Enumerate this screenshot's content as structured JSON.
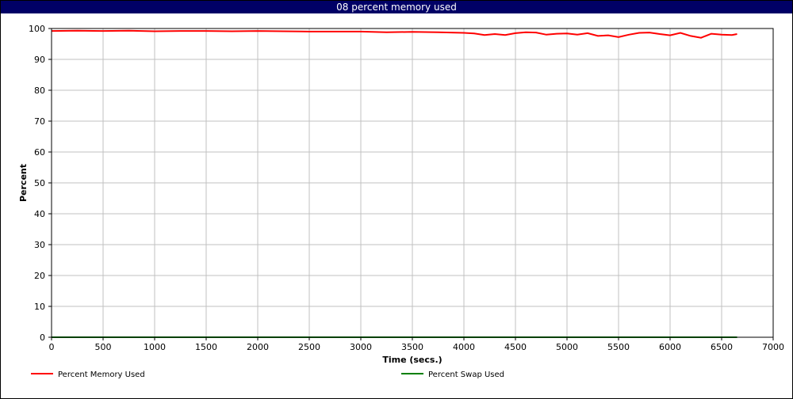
{
  "chart_data": {
    "type": "line",
    "title": "08 percent memory used",
    "xlabel": "Time (secs.)",
    "ylabel": "Percent",
    "xlim": [
      0,
      7000
    ],
    "ylim": [
      0,
      100
    ],
    "x_ticks": [
      0,
      500,
      1000,
      1500,
      2000,
      2500,
      3000,
      3500,
      4000,
      4500,
      5000,
      5500,
      6000,
      6500,
      7000
    ],
    "y_ticks": [
      0,
      10,
      20,
      30,
      40,
      50,
      60,
      70,
      80,
      90,
      100
    ],
    "grid": true,
    "legend_position": "bottom",
    "series": [
      {
        "name": "Percent Memory Used",
        "color": "#ff0000",
        "x": [
          0,
          250,
          500,
          750,
          1000,
          1250,
          1500,
          1750,
          2000,
          2250,
          2500,
          2750,
          3000,
          3250,
          3500,
          3750,
          4000,
          4100,
          4200,
          4300,
          4400,
          4500,
          4600,
          4700,
          4800,
          4900,
          5000,
          5100,
          5200,
          5300,
          5400,
          5500,
          5600,
          5700,
          5800,
          5900,
          6000,
          6100,
          6200,
          6300,
          6400,
          6500,
          6600,
          6650
        ],
        "y": [
          99.2,
          99.3,
          99.2,
          99.3,
          99.1,
          99.2,
          99.2,
          99.1,
          99.2,
          99.1,
          99.0,
          99.0,
          99.0,
          98.8,
          98.9,
          98.8,
          98.6,
          98.4,
          97.9,
          98.2,
          97.9,
          98.5,
          98.8,
          98.7,
          98.0,
          98.3,
          98.4,
          98.0,
          98.5,
          97.6,
          97.8,
          97.2,
          98.0,
          98.6,
          98.7,
          98.2,
          97.8,
          98.6,
          97.6,
          97.0,
          98.3,
          98.0,
          97.9,
          98.2
        ]
      },
      {
        "name": "Percent Swap Used",
        "color": "#008000",
        "x": [
          0,
          6650
        ],
        "y": [
          0,
          0
        ]
      }
    ]
  }
}
